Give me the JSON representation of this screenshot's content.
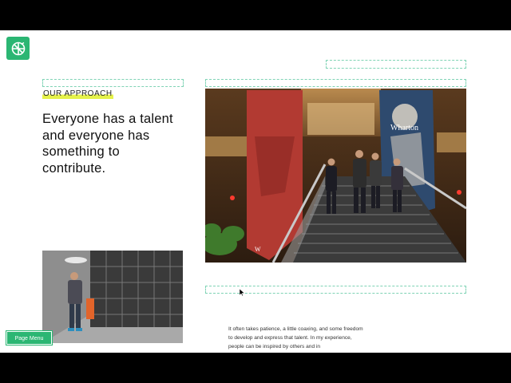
{
  "brand": {
    "logo_icon": "wharton-leaf-logo-icon",
    "accent_color": "#2bb673",
    "highlight_color": "#e5f24a"
  },
  "section": {
    "eyebrow": "OUR APPROACH",
    "headline": "Everyone has a talent and everyone has something to contribute."
  },
  "hero_image": {
    "banner_text": "Wharton",
    "banner_small_text": "W"
  },
  "body": {
    "paragraph": "It often takes patience, a little coaxing, and some freedom to develop and express that talent. In my experience, people can be inspired by others and in"
  },
  "footer": {
    "page_menu_label": "Page Menu"
  }
}
